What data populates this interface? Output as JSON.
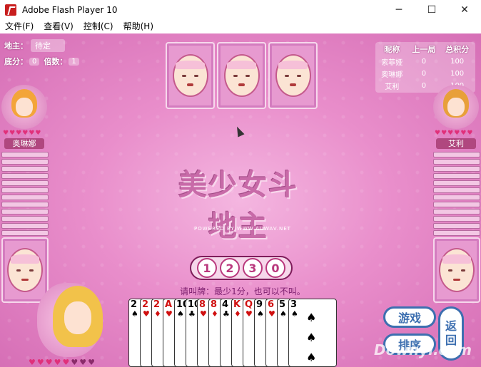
{
  "window": {
    "title": "Adobe Flash Player 10",
    "controls": [
      "─",
      "☐",
      "✕"
    ]
  },
  "menu": [
    "文件(F)",
    "查看(V)",
    "控制(C)",
    "帮助(H)"
  ],
  "info": {
    "landlord_label": "地主：",
    "landlord_value": "待定",
    "base_label": "底分：",
    "base_value": "0",
    "multiple_label": "倍数：",
    "multiple_value": "1"
  },
  "score_table": {
    "headers": [
      "昵称",
      "上一局",
      "总积分"
    ],
    "rows": [
      {
        "name": "索菲娅",
        "last": "0",
        "total": "100"
      },
      {
        "name": "奥琳娜",
        "last": "0",
        "total": "100"
      },
      {
        "name": "艾利",
        "last": "0",
        "total": "100"
      }
    ]
  },
  "players": {
    "left_name": "奥琳娜",
    "right_name": "艾利"
  },
  "logo": {
    "title": "美少女斗地主",
    "powered_by": "POWERED BY WWW.AUWAV.NET"
  },
  "bid_buttons": [
    "1",
    "2",
    "3",
    "0"
  ],
  "prompt": "请叫牌：最少1分，也可以不叫。",
  "hand": [
    {
      "rank": "2",
      "suit": "♠",
      "color": "black"
    },
    {
      "rank": "2",
      "suit": "♥",
      "color": "red"
    },
    {
      "rank": "2",
      "suit": "♦",
      "color": "red"
    },
    {
      "rank": "A",
      "suit": "♥",
      "color": "red"
    },
    {
      "rank": "10",
      "suit": "♠",
      "color": "black"
    },
    {
      "rank": "10",
      "suit": "♣",
      "color": "black"
    },
    {
      "rank": "8",
      "suit": "♥",
      "color": "red"
    },
    {
      "rank": "8",
      "suit": "♦",
      "color": "red"
    },
    {
      "rank": "4",
      "suit": "♣",
      "color": "black"
    },
    {
      "rank": "K",
      "suit": "♦",
      "color": "red"
    },
    {
      "rank": "Q",
      "suit": "♥",
      "color": "red"
    },
    {
      "rank": "9",
      "suit": "♠",
      "color": "black"
    },
    {
      "rank": "6",
      "suit": "♥",
      "color": "red"
    },
    {
      "rank": "5",
      "suit": "♠",
      "color": "black"
    },
    {
      "rank": "3",
      "suit": "♠",
      "color": "black"
    }
  ],
  "actions": {
    "game": "游戏",
    "sort": "排序",
    "back_top": "返",
    "back_bottom": "回"
  },
  "watermark": "Downyi.com",
  "colors": {
    "table_bg": "#e98ecb",
    "button_blue": "#3d6fb0",
    "heart_red": "#e0307a"
  }
}
